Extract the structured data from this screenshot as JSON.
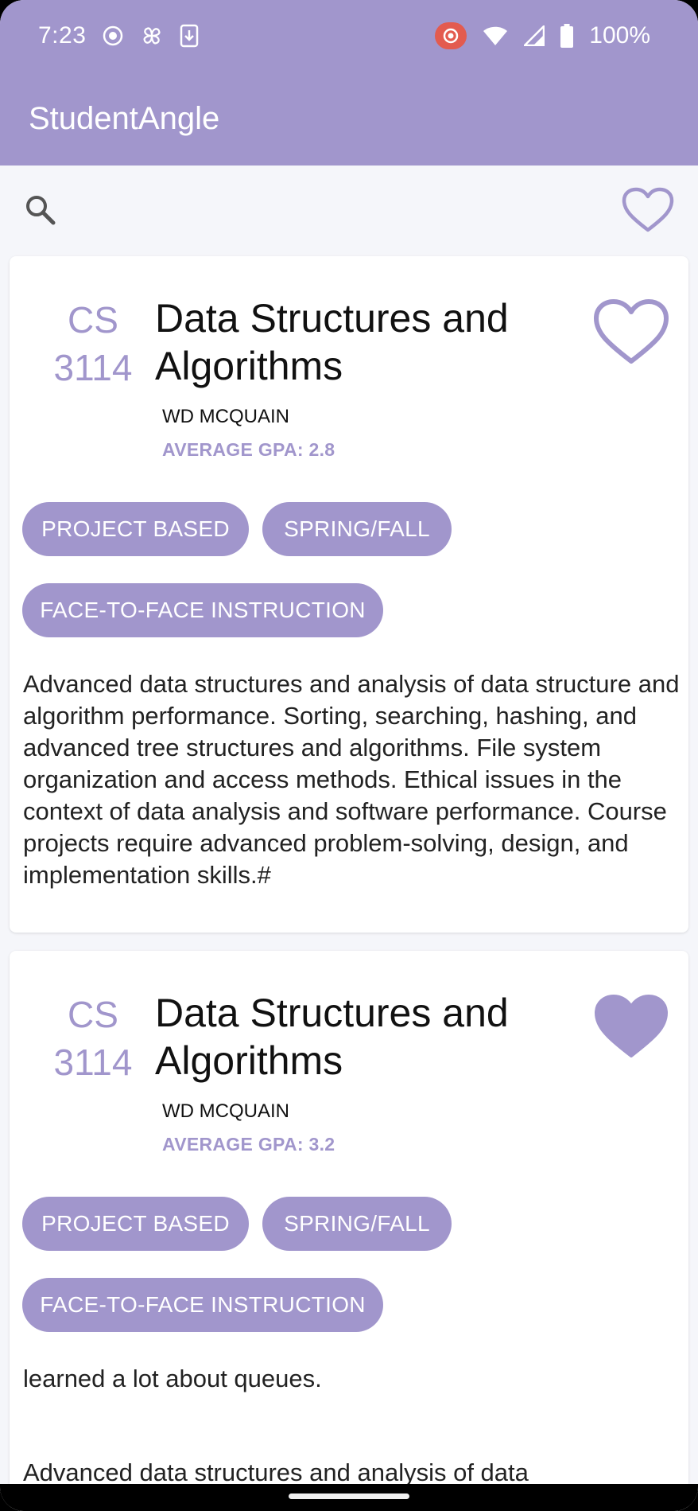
{
  "status_bar": {
    "time": "7:23",
    "battery": "100%",
    "icons": [
      "screen-record-icon",
      "pinwheel-icon",
      "download-icon",
      "record-badge-icon",
      "wifi-icon",
      "signal-icon",
      "battery-icon"
    ]
  },
  "app": {
    "title": "StudentAngle",
    "accent_color": "#a196cc"
  },
  "toolbar": {
    "icons": [
      "search-icon",
      "favorites-heart-icon"
    ]
  },
  "courses": [
    {
      "code_dept": "CS",
      "code_num": "3114",
      "title_line1": "Data Structures and",
      "title_line2": "Algorithms",
      "instructor": "WD MCQUAIN",
      "gpa_label": "AVERAGE GPA: 2.8",
      "favorited": false,
      "tags": [
        "PROJECT BASED",
        "SPRING/FALL",
        "FACE-TO-FACE INSTRUCTION"
      ],
      "description": "Advanced data structures and analysis of data structure and algorithm performance. Sorting, searching, hashing, and advanced tree structures and algorithms. File system organization and access methods. Ethical issues in the context of data analysis and software performance. Course projects require advanced problem-solving, design, and implementation skills.#"
    },
    {
      "code_dept": "CS",
      "code_num": "3114",
      "title_line1": "Data Structures and",
      "title_line2": "Algorithms",
      "instructor": "WD MCQUAIN",
      "gpa_label": "AVERAGE GPA: 3.2",
      "favorited": true,
      "tags": [
        "PROJECT BASED",
        "SPRING/FALL",
        "FACE-TO-FACE INSTRUCTION"
      ],
      "comment": "learned a lot about queues.",
      "description": "Advanced data structures and analysis of data"
    }
  ]
}
